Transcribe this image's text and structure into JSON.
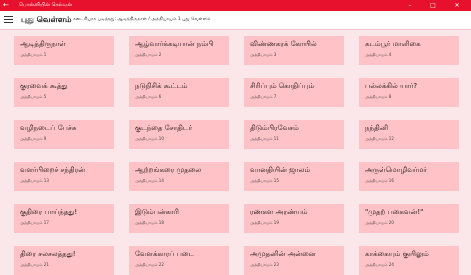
{
  "window": {
    "app_title": "பொன்னியின் செல்வன்",
    "back_icon": "back-arrow-icon",
    "minimize_icon": "minimize-icon",
    "maximize_icon": "maximize-icon",
    "close_icon": "close-icon"
  },
  "header": {
    "menu_icon": "hamburger-menu-icon",
    "title": "புது வெள்ளம்",
    "breadcrumb": "கடைசியாக படித்தது: ஆடித்திருநாள் / அத்தியாயம் 1 புது வெள்ளம்"
  },
  "tiles": [
    {
      "name": "ஆடித்திருநாள்",
      "sub": "அத்தியாயம் 1"
    },
    {
      "name": "ஆழ்வார்க்கடியான் நம்பி",
      "sub": "அத்தியாயம் 2"
    },
    {
      "name": "விண்ணகரக் கோயில்",
      "sub": "அத்தியாயம் 3"
    },
    {
      "name": "கடம்பூர் மாளிகை",
      "sub": "அத்தியாயம் 4"
    },
    {
      "name": "குரவைக் கூத்து",
      "sub": "அத்தியாயம் 5"
    },
    {
      "name": "நடுநிசிக் கூட்டம்",
      "sub": "அத்தியாயம் 6"
    },
    {
      "name": "சிரிப்பும் கொதிப்பும்",
      "sub": "அத்தியாயம் 7"
    },
    {
      "name": "பல்லக்கில் யார்?",
      "sub": "அத்தியாயம் 8"
    },
    {
      "name": "வழிநடைப் பேச்சு",
      "sub": "அத்தியாயம் 9"
    },
    {
      "name": "குடந்தை சோதிடர்",
      "sub": "அத்தியாயம் 10"
    },
    {
      "name": "திடும்பிரவேசம்",
      "sub": "அத்தியாயம் 11"
    },
    {
      "name": "நந்தினி",
      "sub": "அத்தியாயம் 12"
    },
    {
      "name": "வளர்பிறைச் சந்திரன்",
      "sub": "அத்தியாயம் 13"
    },
    {
      "name": "ஆற்றங்கரை முதலை",
      "sub": "அத்தியாயம் 14"
    },
    {
      "name": "வானதியின் ஜாலம்",
      "sub": "அத்தியாயம் 15"
    },
    {
      "name": "அருள்மொழிவர்மர்",
      "sub": "அத்தியாயம் 16"
    },
    {
      "name": "குதிரை பாய்ந்தது!",
      "sub": "அத்தியாயம் 17"
    },
    {
      "name": "இடும்பன்காரி",
      "sub": "அத்தியாயம் 18"
    },
    {
      "name": "ரணகள அரண்யம்",
      "sub": "அத்தியாயம் 19"
    },
    {
      "name": "\"முதற் பகைவன்!\"",
      "sub": "அத்தியாயம் 20"
    },
    {
      "name": "திரை சலசலத்தது!",
      "sub": "அத்தியாயம் 21"
    },
    {
      "name": "வேளக்காரப் படை",
      "sub": "அத்தியாயம் 22"
    },
    {
      "name": "அமுதனின் அன்னை",
      "sub": "அத்தியாயம் 23"
    },
    {
      "name": "காக்கையும் குயிலும்",
      "sub": "அத்தியாயம் 24"
    }
  ]
}
